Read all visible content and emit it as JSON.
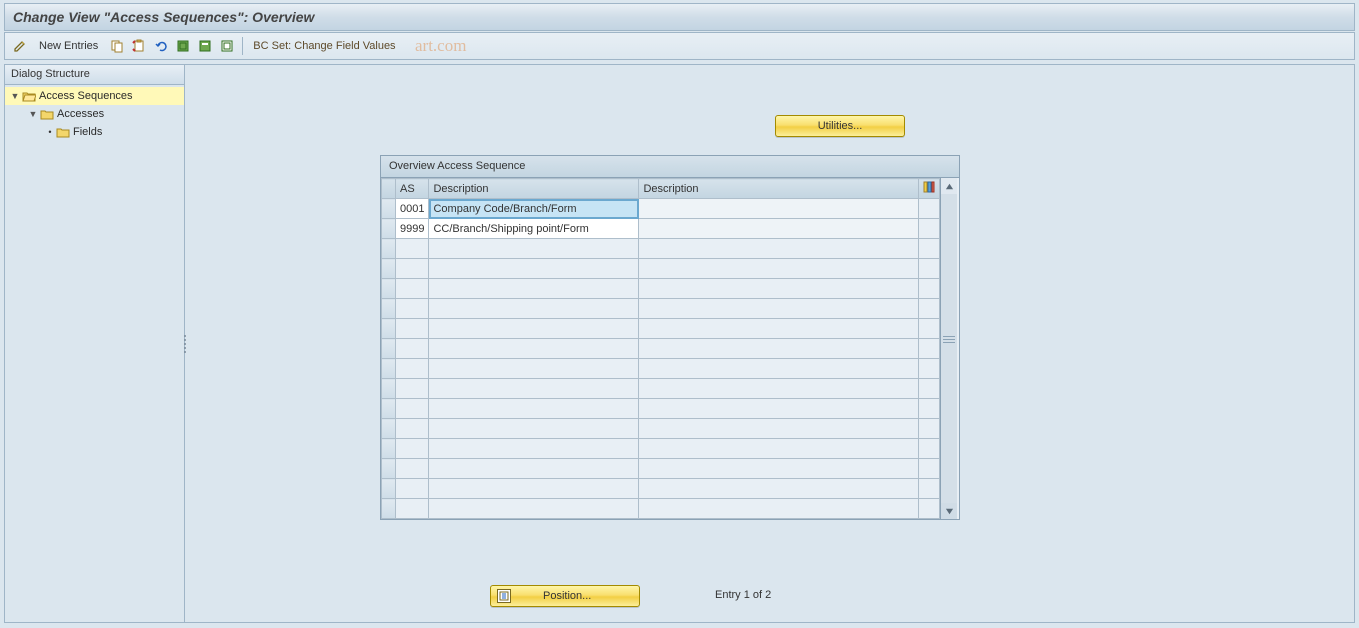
{
  "header": {
    "title": "Change View \"Access Sequences\": Overview"
  },
  "toolbar": {
    "new_entries_label": "New Entries",
    "bc_set_label": "BC Set: Change Field Values",
    "icons": {
      "edit": "edit-icon",
      "copy": "copy-icon",
      "to_clipboard": "clipboard-icon",
      "undo": "undo-icon",
      "select_all": "select-all-icon",
      "select_block": "select-block-icon",
      "deselect": "deselect-icon"
    }
  },
  "watermark": "art.com",
  "sidebar": {
    "header": "Dialog Structure",
    "items": [
      {
        "label": "Access Sequences",
        "level": 0,
        "expanded": true,
        "selected": true,
        "icon": "folder-open"
      },
      {
        "label": "Accesses",
        "level": 1,
        "expanded": true,
        "selected": false,
        "icon": "folder-closed"
      },
      {
        "label": "Fields",
        "level": 2,
        "expanded": false,
        "selected": false,
        "icon": "folder-closed"
      }
    ]
  },
  "main": {
    "utilities_label": "Utilities...",
    "table": {
      "title": "Overview Access Sequence",
      "columns": {
        "as": "AS",
        "description": "Description",
        "description2": "Description"
      },
      "rows": [
        {
          "as": "0001",
          "desc": "Company Code/Branch/Form",
          "desc2": "",
          "editing": true
        },
        {
          "as": "9999",
          "desc": "CC/Branch/Shipping point/Form",
          "desc2": "",
          "editing": false
        }
      ],
      "empty_row_count": 14
    },
    "position_label": "Position...",
    "entry_status_prefix": "Entry ",
    "entry_current": "1",
    "entry_of": " of ",
    "entry_total": "2"
  }
}
